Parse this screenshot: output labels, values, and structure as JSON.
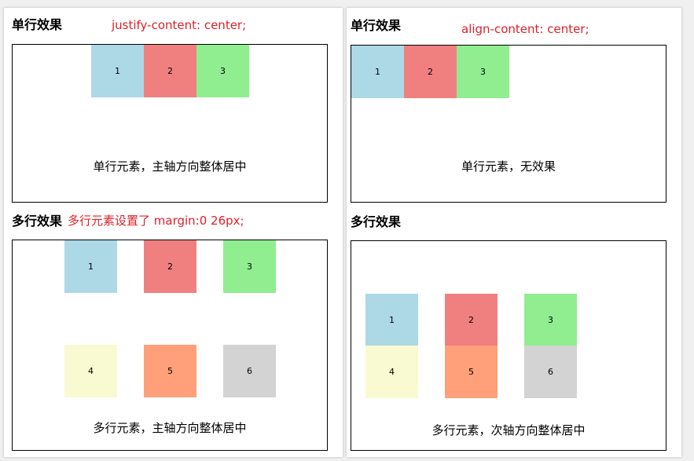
{
  "left": {
    "single": {
      "heading": "单行效果",
      "annotation": "justify-content: center;",
      "items": [
        "1",
        "2",
        "3"
      ],
      "caption": "单行元素，主轴方向整体居中"
    },
    "multi": {
      "heading": "多行效果",
      "annotation": "多行元素设置了 margin:0 26px;",
      "items": [
        "1",
        "2",
        "3",
        "4",
        "5",
        "6"
      ],
      "caption": "多行元素，主轴方向整体居中"
    }
  },
  "right": {
    "single": {
      "heading": "单行效果",
      "annotation": "align-content: center;",
      "items": [
        "1",
        "2",
        "3"
      ],
      "caption": "单行元素，无效果"
    },
    "multi": {
      "heading": "多行效果",
      "items": [
        "1",
        "2",
        "3",
        "4",
        "5",
        "6"
      ],
      "caption": "多行元素，次轴方向整体居中"
    }
  },
  "colors": {
    "item_1": "#add8e6",
    "item_2": "#f08080",
    "item_3": "#90ee90",
    "item_4": "#fafad2",
    "item_5": "#ffa07a",
    "item_6": "#d3d3d3",
    "annotation": "#e0202a"
  }
}
